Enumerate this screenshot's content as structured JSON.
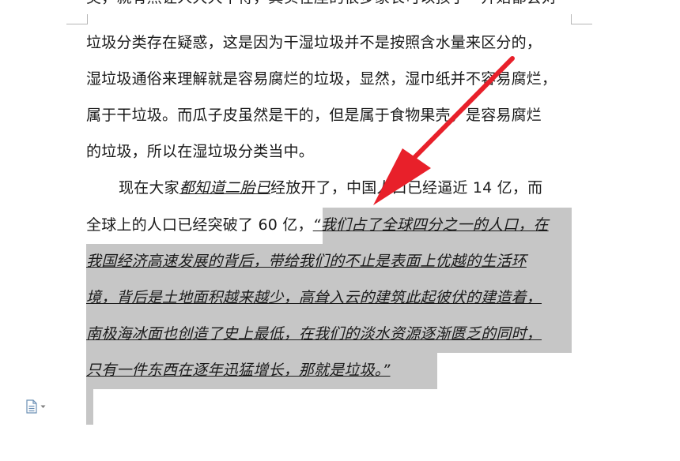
{
  "document": {
    "top_cut_line": "类，就有然让人大大不得，其实在座的很多家长可以孩子一开始都会对",
    "line1": "垃圾分类存在疑惑，这是因为干湿垃圾并不是按照含水量来区分的，",
    "line2": "湿垃圾通俗来理解就是容易腐烂的垃圾，显然，湿巾纸并不容易腐烂，",
    "line3": "属于干垃圾。而瓜子皮虽然是干的，但是属于食物果壳，是容易腐烂",
    "line4": "的垃圾，所以在湿垃圾分类当中。",
    "line5_pre": "现在大家",
    "line5_em": "都知道二胎已",
    "line5_post": "经放开了，中国人口已经逼近 14 亿，而",
    "line6_plain": "全球上的人口已经突破了 60 亿，",
    "line6_sel": "“我们占了全球四分之一的人口，在",
    "line7_sel": "我国经济高速发展的背后，带给我们的不止是表面上优越的生活环",
    "line8_sel": "境，背后是土地面积越来越少，高耸入云的建筑此起彼伏的建造着，",
    "line9_sel": "南极海冰面也创造了史上最低，在我们的淡水资源逐渐匮乏的同时，",
    "line10_sel": "只有一件东西在逐年迅猛增长，那就是垃圾。”"
  },
  "colors": {
    "selection": "#c6c6c6",
    "arrow": "#e8202a",
    "icon": "#6b8fb5"
  },
  "icons": {
    "paste_options": "paste-options-icon"
  }
}
